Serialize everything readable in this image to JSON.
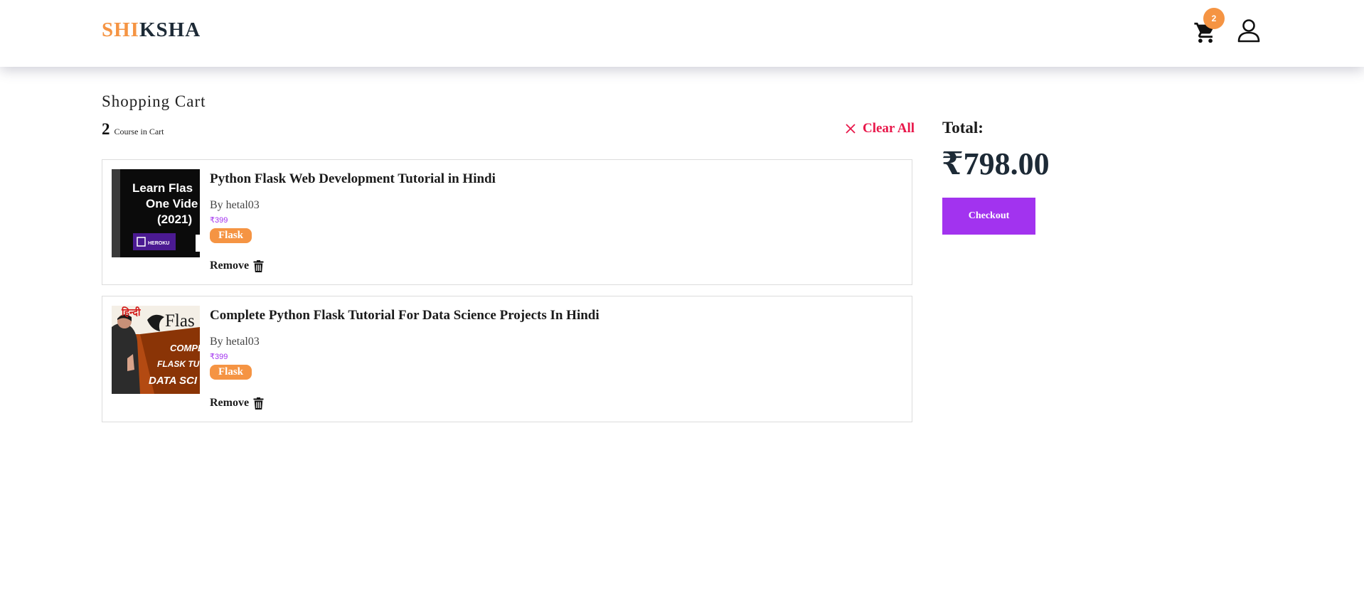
{
  "header": {
    "logo_part1": "SHI",
    "logo_part2": "KSHA",
    "cart_count": "2",
    "cart_icon": "shopping-cart-icon",
    "user_icon": "user-icon"
  },
  "cart": {
    "title": "Shopping Cart",
    "count": "2",
    "count_label": "Course in Cart",
    "clear_all_label": "Clear All",
    "items": [
      {
        "title": "Python Flask Web Development Tutorial in Hindi",
        "author": "By hetal03",
        "price": "₹399",
        "tag": "Flask",
        "remove_label": "Remove",
        "thumbnail_text": [
          "Learn Flas",
          "One Vide",
          "(2021)",
          "HEROKU"
        ]
      },
      {
        "title": "Complete Python Flask Tutorial For Data Science Projects In Hindi",
        "author": "By hetal03",
        "price": "₹399",
        "tag": "Flask",
        "remove_label": "Remove",
        "thumbnail_text": [
          "हिन्दी",
          "Flas",
          "COMPL",
          "FLASK TUT",
          "DATA SCI"
        ]
      }
    ]
  },
  "summary": {
    "total_label": "Total:",
    "total_amount": "₹798.00",
    "checkout_label": "Checkout"
  },
  "colors": {
    "brand_orange": "#f59443",
    "brand_dark": "#1d2a36",
    "accent_purple": "#a233ef",
    "danger_red": "#e8174a"
  }
}
